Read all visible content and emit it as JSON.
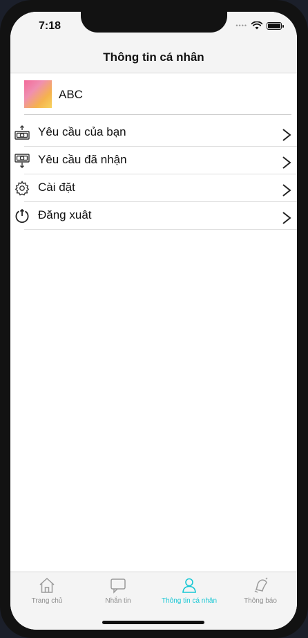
{
  "status": {
    "time": "7:18"
  },
  "nav": {
    "title": "Thông tin cá nhân"
  },
  "profile": {
    "name": "ABC"
  },
  "menu": {
    "items": [
      {
        "label": "Yêu cầu của bạn",
        "icon": "send-money-icon"
      },
      {
        "label": "Yêu cầu đã nhận",
        "icon": "receive-money-icon"
      },
      {
        "label": "Cài đặt",
        "icon": "gear-icon"
      },
      {
        "label": "Đăng xuât",
        "icon": "power-icon"
      }
    ],
    "chevron": ">"
  },
  "tabs": [
    {
      "label": "Trang chủ",
      "icon": "home-icon",
      "active": false
    },
    {
      "label": "Nhắn tin",
      "icon": "chat-bubble-icon",
      "active": false
    },
    {
      "label": "Thông tin cá nhân",
      "icon": "person-icon",
      "active": true
    },
    {
      "label": "Thông báo",
      "icon": "bell-icon",
      "active": false
    }
  ],
  "colors": {
    "accent": "#17c7d4",
    "inactive_tab": "#8e8e8e"
  }
}
